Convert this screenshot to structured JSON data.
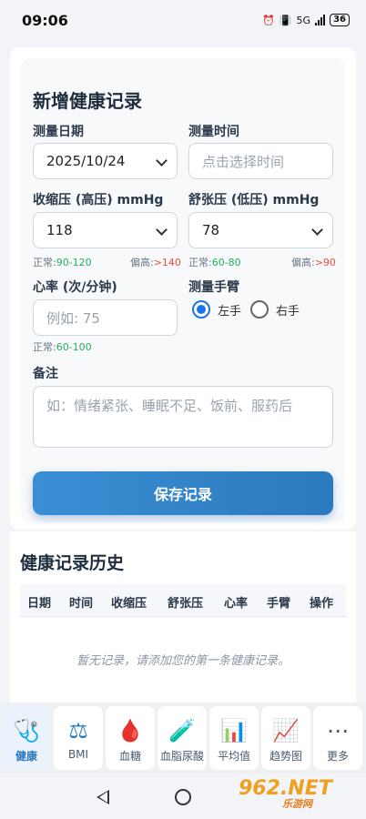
{
  "status_bar": {
    "time": "09:06",
    "network": "5G",
    "battery": "36"
  },
  "form": {
    "title": "新增健康记录",
    "date_label": "测量日期",
    "date_value": "2025/10/24",
    "time_label": "测量时间",
    "time_placeholder": "点击选择时间",
    "systolic_label": "收缩压 (高压) mmHg",
    "systolic_value": "118",
    "systolic_normal_prefix": "正常:",
    "systolic_normal": "90-120",
    "systolic_high_prefix": "偏高:",
    "systolic_high": ">140",
    "diastolic_label": "舒张压 (低压) mmHg",
    "diastolic_value": "78",
    "diastolic_normal_prefix": "正常:",
    "diastolic_normal": "60-80",
    "diastolic_high_prefix": "偏高:",
    "diastolic_high": ">90",
    "heart_rate_label": "心率 (次/分钟)",
    "heart_rate_placeholder": "例如: 75",
    "heart_rate_normal_prefix": "正常:",
    "heart_rate_normal": "60-100",
    "arm_label": "测量手臂",
    "arm_left": "左手",
    "arm_right": "右手",
    "arm_selected": "左手",
    "notes_label": "备注",
    "notes_placeholder": "如：情绪紧张、睡眠不足、饭前、服药后",
    "save_button": "保存记录"
  },
  "history": {
    "title": "健康记录历史",
    "columns": [
      "日期",
      "时间",
      "收缩压",
      "舒张压",
      "心率",
      "手臂",
      "操作"
    ],
    "empty_message": "暂无记录，请添加您的第一条健康记录。"
  },
  "bottom_nav": [
    {
      "label": "健康",
      "icon": "stethoscope-icon",
      "glyph": "🩺",
      "active": true
    },
    {
      "label": "BMI",
      "icon": "scale-icon",
      "glyph": "⚖",
      "active": false
    },
    {
      "label": "血糖",
      "icon": "blood-drop-icon",
      "glyph": "🩸",
      "active": false
    },
    {
      "label": "血脂尿酸",
      "icon": "test-tube-icon",
      "glyph": "🧪",
      "active": false
    },
    {
      "label": "平均值",
      "icon": "bar-chart-icon",
      "glyph": "📊",
      "active": false
    },
    {
      "label": "趋势图",
      "icon": "line-chart-icon",
      "glyph": "📈",
      "active": false
    },
    {
      "label": "更多",
      "icon": "more-icon",
      "glyph": "⋯",
      "active": false
    }
  ],
  "watermark": {
    "text": "962.NET",
    "sub": "乐游网"
  },
  "colors": {
    "accent": "#2c79bd",
    "normal": "#27ae60",
    "high": "#e74c3c"
  }
}
